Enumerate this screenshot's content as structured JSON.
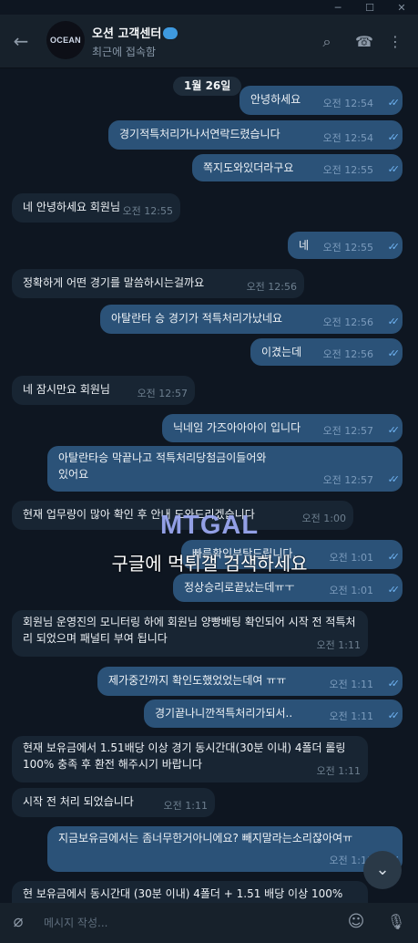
{
  "window": {
    "minimize": "─",
    "maximize": "☐",
    "close": "✕"
  },
  "header": {
    "back": "←",
    "avatar_text": "OCEAN",
    "title": "오션 고객센터",
    "status": "최근에 접속함",
    "search_icon": "⌕",
    "call_icon": "☎",
    "more_icon": "⋮"
  },
  "chat": {
    "date": "1월 26일",
    "messages": [
      {
        "dir": "out",
        "text": "안녕하세요",
        "time": "오전 12:54"
      },
      {
        "dir": "out",
        "text": "경기적특처리가나서연락드렸습니다",
        "time": "오전 12:54"
      },
      {
        "dir": "out",
        "text": "쪽지도와있더라구요",
        "time": "오전 12:55"
      },
      {
        "dir": "in",
        "text": "네 안녕하세요 회원님",
        "time": "오전 12:55"
      },
      {
        "dir": "out",
        "text": "네",
        "time": "오전 12:55"
      },
      {
        "dir": "in",
        "text": "정확하게 어떤 경기를 말씀하시는걸까요",
        "time": "오전 12:56"
      },
      {
        "dir": "out",
        "text": "아탈란타 승 경기가 적특처리가났네요",
        "time": "오전 12:56"
      },
      {
        "dir": "out",
        "text": "이겼는데",
        "time": "오전 12:56"
      },
      {
        "dir": "in",
        "text": "네 잠시만요 회원님",
        "time": "오전 12:57"
      },
      {
        "dir": "out",
        "text": "닉네임 가즈아아아이 입니다",
        "time": "오전 12:57"
      },
      {
        "dir": "out",
        "text": "아탈란타승 막끝나고 적특처리당첨금이들어와있어요",
        "time": "오전 12:57"
      },
      {
        "dir": "in",
        "text": "현재 업무량이 많아 확인 후 안내 도와드리겠습니다",
        "time": "오전 1:00"
      },
      {
        "dir": "out",
        "text": "빠른확인부탁드립니다.",
        "time": "오전 1:01"
      },
      {
        "dir": "out",
        "text": "정상승리로끝났는데ㅠㅜ",
        "time": "오전 1:01"
      },
      {
        "dir": "in",
        "text": "회원님 운영진의 모니터링 하에 회원님 양빵배팅 확인되어 시작 전 적특처리 되었으며 패널티 부여 됩니다",
        "time": "오전 1:11"
      },
      {
        "dir": "out",
        "text": "제가중간까지 확인도했었었는데여 ㅠㅠ",
        "time": "오전 1:11"
      },
      {
        "dir": "out",
        "text": "경기끝나니깐적특처리가되서..",
        "time": "오전 1:11"
      },
      {
        "dir": "in",
        "text": "현재 보유금에서 1.51배당 이상 경기 동시간대(30분 이내) 4폴더 롤링 100% 충족 후 환전 해주시기 바랍니다",
        "time": "오전 1:11"
      },
      {
        "dir": "in",
        "text": "시작 전 처리 되었습니다",
        "time": "오전 1:11"
      },
      {
        "dir": "out",
        "text": "지금보유금에서는 좀너무한거아니에요? 빼지말라는소리잖아여ㅠ",
        "time": "오전 1:11"
      },
      {
        "dir": "in",
        "text": "현 보유금에서 동시간대 (30분 이내) 4폴더 + 1.51 배당 이상 100%",
        "time": ""
      }
    ],
    "watermark": "MTGAL",
    "watermark_sub": "구글에 먹튀갤 검색하세요",
    "scroll_icon": "⌄"
  },
  "composer": {
    "attach_icon": "⌀",
    "placeholder": "메시지 작성...",
    "emoji_icon": "☺",
    "mic_icon": "🎙"
  }
}
